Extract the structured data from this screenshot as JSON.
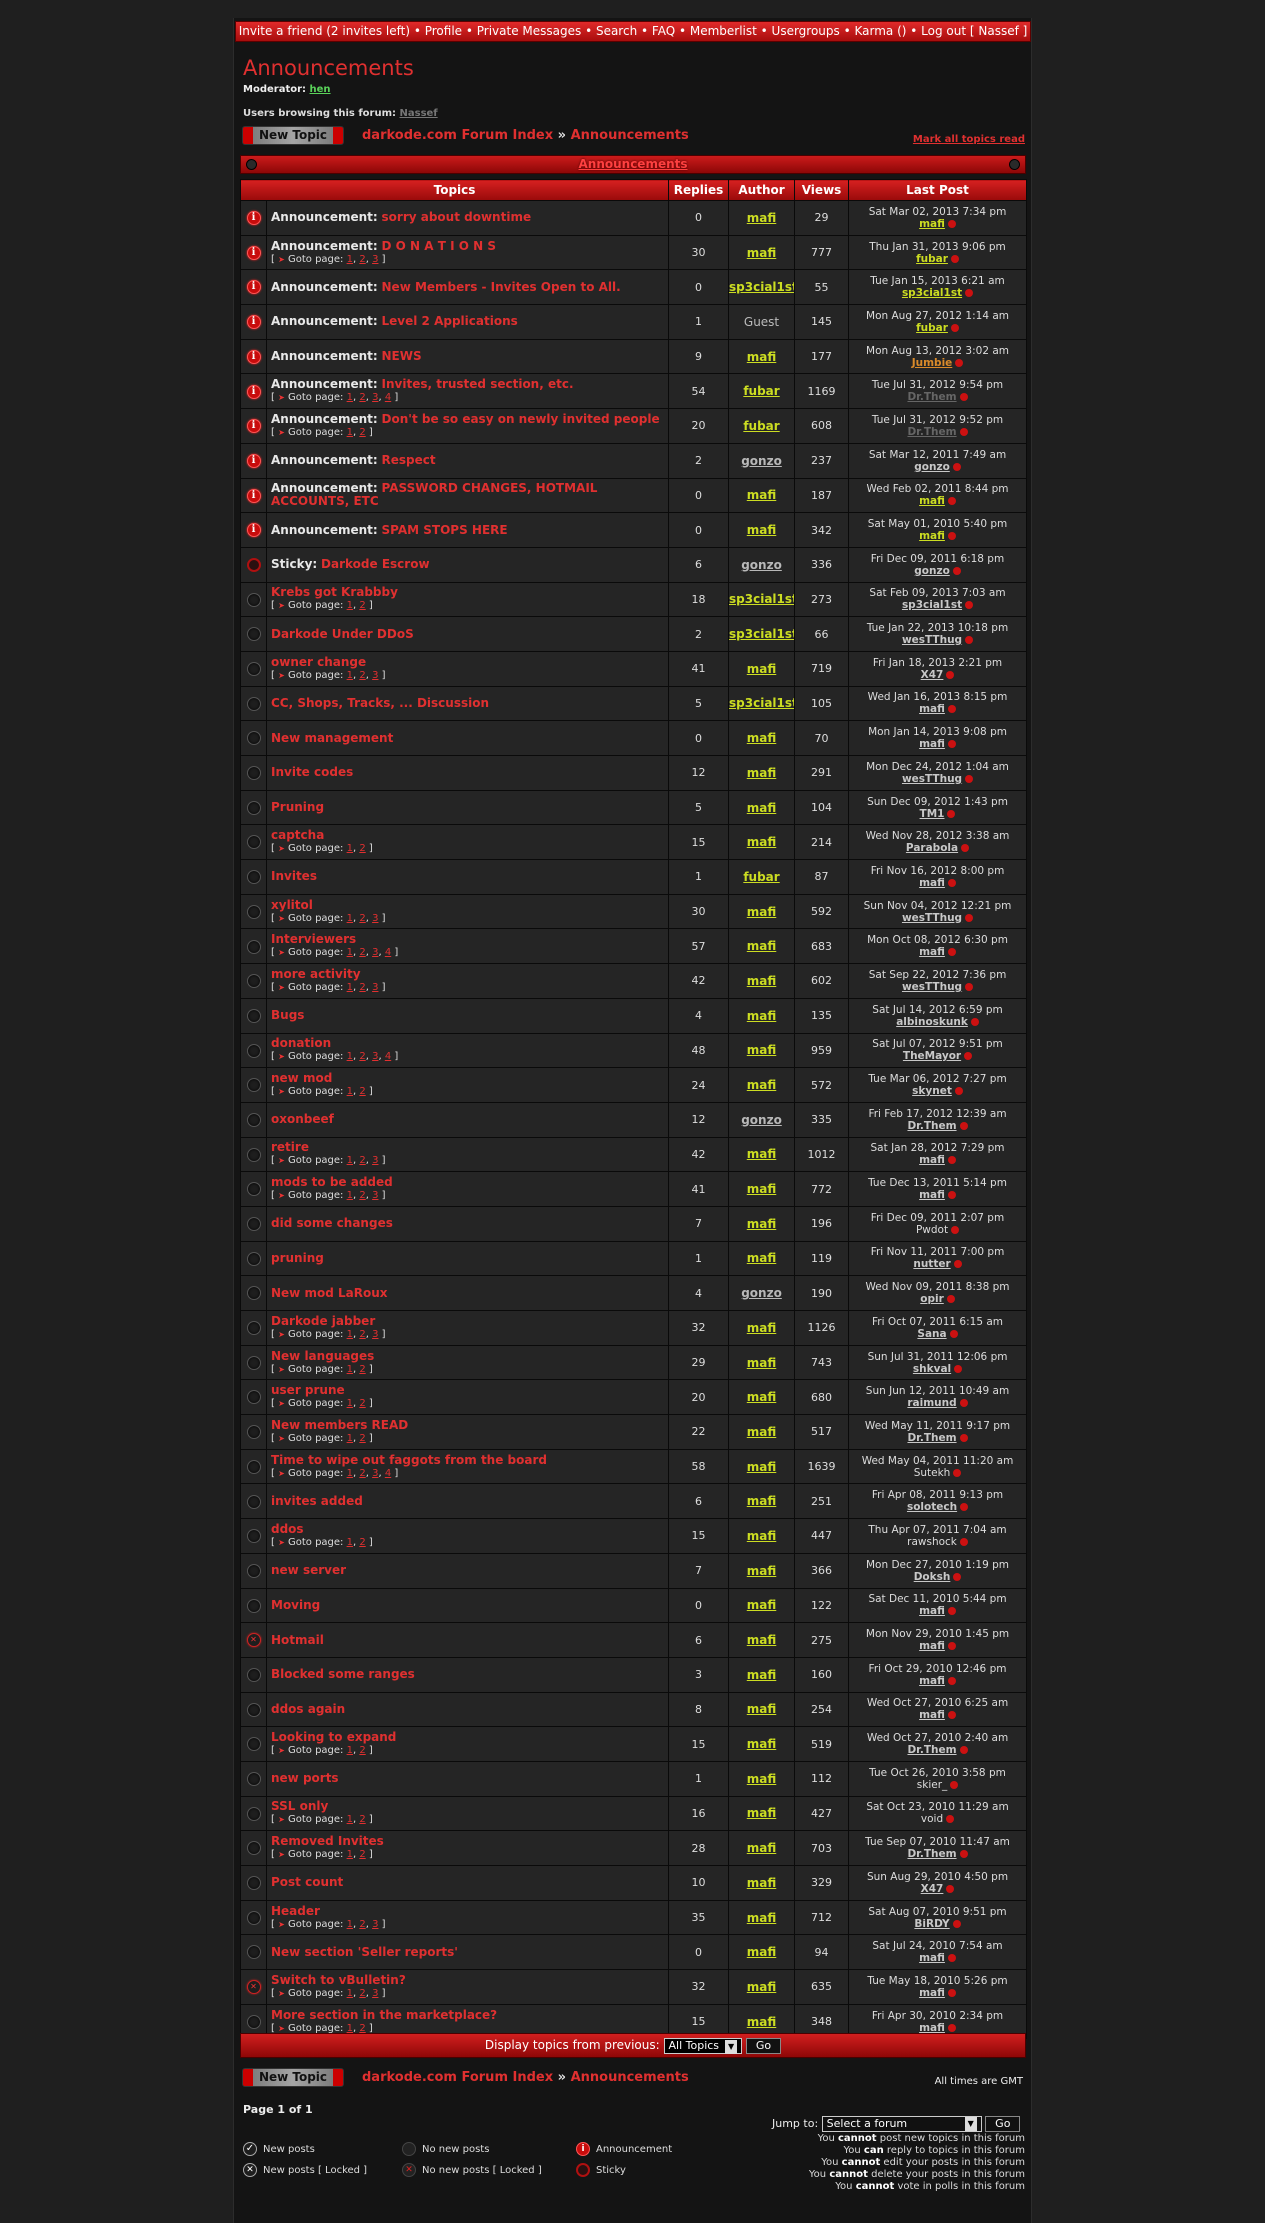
{
  "topnav": "Invite a friend (2 invites left) • Profile • Private Messages • Search • FAQ • Memberlist • Usergroups • Karma () • Log out [ Nassef ]",
  "forum": {
    "title": "Announcements",
    "moderator_label": "Moderator:",
    "moderator": "hen",
    "browsing_label": "Users browsing this forum:",
    "browsing_user": "Nassef"
  },
  "actions": {
    "new_topic": "New Topic",
    "mark_read": "Mark all topics read"
  },
  "breadcrumb": {
    "index": "darkode.com Forum Index",
    "sep": "»",
    "current": "Announcements"
  },
  "table": {
    "caption": "Announcements",
    "headers": {
      "topics": "Topics",
      "replies": "Replies",
      "author": "Author",
      "views": "Views",
      "last_post": "Last Post"
    },
    "goto_label": "Goto page:",
    "rows": [
      {
        "icon": "announcement",
        "prefix": "Announcement:",
        "title": "sorry about downtime",
        "pages": [],
        "replies": "0",
        "author": "mafi",
        "ac": "yellow",
        "views": "29",
        "date": "Sat Mar 02, 2013 7:34 pm",
        "user": "mafi",
        "uc": "yellow"
      },
      {
        "icon": "announcement",
        "prefix": "Announcement:",
        "title": "D O N A T I O N S",
        "pages": [
          "1",
          "2",
          "3"
        ],
        "replies": "30",
        "author": "mafi",
        "ac": "yellow",
        "views": "777",
        "date": "Thu Jan 31, 2013 9:06 pm",
        "user": "fubar",
        "uc": "yellow"
      },
      {
        "icon": "announcement",
        "prefix": "Announcement:",
        "title": "New Members - Invites Open to All.",
        "pages": [],
        "replies": "0",
        "author": "sp3cial1st",
        "ac": "yellow",
        "views": "55",
        "date": "Tue Jan 15, 2013 6:21 am",
        "user": "sp3cial1st",
        "uc": "yellow"
      },
      {
        "icon": "announcement",
        "prefix": "Announcement:",
        "title": "Level 2 Applications",
        "pages": [],
        "replies": "1",
        "author": "Guest",
        "ac": "plain",
        "views": "145",
        "date": "Mon Aug 27, 2012 1:14 am",
        "user": "fubar",
        "uc": "yellow"
      },
      {
        "icon": "announcement",
        "prefix": "Announcement:",
        "title": "NEWS",
        "pages": [],
        "replies": "9",
        "author": "mafi",
        "ac": "yellow",
        "views": "177",
        "date": "Mon Aug 13, 2012 3:02 am",
        "user": "Jumbie",
        "uc": "orange"
      },
      {
        "icon": "announcement",
        "prefix": "Announcement:",
        "title": "Invites, trusted section, etc.",
        "pages": [
          "1",
          "2",
          "3",
          "4"
        ],
        "replies": "54",
        "author": "fubar",
        "ac": "yellow",
        "views": "1169",
        "date": "Tue Jul 31, 2012 9:54 pm",
        "user": "Dr.Them",
        "uc": "dim"
      },
      {
        "icon": "announcement",
        "prefix": "Announcement:",
        "title": "Don't be so easy on newly invited people",
        "pages": [
          "1",
          "2"
        ],
        "replies": "20",
        "author": "fubar",
        "ac": "yellow",
        "views": "608",
        "date": "Tue Jul 31, 2012 9:52 pm",
        "user": "Dr.Them",
        "uc": "dim"
      },
      {
        "icon": "announcement",
        "prefix": "Announcement:",
        "title": "Respect",
        "pages": [],
        "replies": "2",
        "author": "gonzo",
        "ac": "gray",
        "views": "237",
        "date": "Sat Mar 12, 2011 7:49 am",
        "user": "gonzo",
        "uc": "gray"
      },
      {
        "icon": "announcement",
        "prefix": "Announcement:",
        "title": "PASSWORD CHANGES, HOTMAIL ACCOUNTS, ETC",
        "pages": [],
        "replies": "0",
        "author": "mafi",
        "ac": "yellow",
        "views": "187",
        "date": "Wed Feb 02, 2011 8:44 pm",
        "user": "mafi",
        "uc": "yellow"
      },
      {
        "icon": "announcement",
        "prefix": "Announcement:",
        "title": "SPAM STOPS HERE",
        "pages": [],
        "replies": "0",
        "author": "mafi",
        "ac": "yellow",
        "views": "342",
        "date": "Sat May 01, 2010 5:40 pm",
        "user": "mafi",
        "uc": "yellow"
      },
      {
        "icon": "sticky",
        "prefix": "Sticky:",
        "title": "Darkode Escrow",
        "pages": [],
        "replies": "6",
        "author": "gonzo",
        "ac": "gray",
        "views": "336",
        "date": "Fri Dec 09, 2011 6:18 pm",
        "user": "gonzo",
        "uc": "gray"
      },
      {
        "icon": "normal",
        "prefix": "",
        "title": "Krebs got Krabbby",
        "pages": [
          "1",
          "2"
        ],
        "replies": "18",
        "author": "sp3cial1st",
        "ac": "yellow",
        "views": "273",
        "date": "Sat Feb 09, 2013 7:03 am",
        "user": "sp3cial1st",
        "uc": "gray"
      },
      {
        "icon": "normal",
        "prefix": "",
        "title": "Darkode Under DDoS",
        "pages": [],
        "replies": "2",
        "author": "sp3cial1st",
        "ac": "yellow",
        "views": "66",
        "date": "Tue Jan 22, 2013 10:18 pm",
        "user": "wesTThug",
        "uc": "gray"
      },
      {
        "icon": "normal",
        "prefix": "",
        "title": "owner change",
        "pages": [
          "1",
          "2",
          "3"
        ],
        "replies": "41",
        "author": "mafi",
        "ac": "yellow",
        "views": "719",
        "date": "Fri Jan 18, 2013 2:21 pm",
        "user": "X47",
        "uc": "gray"
      },
      {
        "icon": "normal",
        "prefix": "",
        "title": "CC, Shops, Tracks, ... Discussion",
        "pages": [],
        "replies": "5",
        "author": "sp3cial1st",
        "ac": "yellow",
        "views": "105",
        "date": "Wed Jan 16, 2013 8:15 pm",
        "user": "mafi",
        "uc": "gray"
      },
      {
        "icon": "normal",
        "prefix": "",
        "title": "New management",
        "pages": [],
        "replies": "0",
        "author": "mafi",
        "ac": "yellow",
        "views": "70",
        "date": "Mon Jan 14, 2013 9:08 pm",
        "user": "mafi",
        "uc": "gray"
      },
      {
        "icon": "normal",
        "prefix": "",
        "title": "Invite codes",
        "pages": [],
        "replies": "12",
        "author": "mafi",
        "ac": "yellow",
        "views": "291",
        "date": "Mon Dec 24, 2012 1:04 am",
        "user": "wesTThug",
        "uc": "gray"
      },
      {
        "icon": "normal",
        "prefix": "",
        "title": "Pruning",
        "pages": [],
        "replies": "5",
        "author": "mafi",
        "ac": "yellow",
        "views": "104",
        "date": "Sun Dec 09, 2012 1:43 pm",
        "user": "TM1",
        "uc": "gray"
      },
      {
        "icon": "normal",
        "prefix": "",
        "title": "captcha",
        "pages": [
          "1",
          "2"
        ],
        "replies": "15",
        "author": "mafi",
        "ac": "yellow",
        "views": "214",
        "date": "Wed Nov 28, 2012 3:38 am",
        "user": "Parabola",
        "uc": "gray"
      },
      {
        "icon": "normal",
        "prefix": "",
        "title": "Invites",
        "pages": [],
        "replies": "1",
        "author": "fubar",
        "ac": "yellow",
        "views": "87",
        "date": "Fri Nov 16, 2012 8:00 pm",
        "user": "mafi",
        "uc": "gray"
      },
      {
        "icon": "normal",
        "prefix": "",
        "title": "xylitol",
        "pages": [
          "1",
          "2",
          "3"
        ],
        "replies": "30",
        "author": "mafi",
        "ac": "yellow",
        "views": "592",
        "date": "Sun Nov 04, 2012 12:21 pm",
        "user": "wesTThug",
        "uc": "gray"
      },
      {
        "icon": "normal",
        "prefix": "",
        "title": "Interviewers",
        "pages": [
          "1",
          "2",
          "3",
          "4"
        ],
        "replies": "57",
        "author": "mafi",
        "ac": "yellow",
        "views": "683",
        "date": "Mon Oct 08, 2012 6:30 pm",
        "user": "mafi",
        "uc": "gray"
      },
      {
        "icon": "normal",
        "prefix": "",
        "title": "more activity",
        "pages": [
          "1",
          "2",
          "3"
        ],
        "replies": "42",
        "author": "mafi",
        "ac": "yellow",
        "views": "602",
        "date": "Sat Sep 22, 2012 7:36 pm",
        "user": "wesTThug",
        "uc": "gray"
      },
      {
        "icon": "normal",
        "prefix": "",
        "title": "Bugs",
        "pages": [],
        "replies": "4",
        "author": "mafi",
        "ac": "yellow",
        "views": "135",
        "date": "Sat Jul 14, 2012 6:59 pm",
        "user": "albinoskunk",
        "uc": "gray"
      },
      {
        "icon": "normal",
        "prefix": "",
        "title": "donation",
        "pages": [
          "1",
          "2",
          "3",
          "4"
        ],
        "replies": "48",
        "author": "mafi",
        "ac": "yellow",
        "views": "959",
        "date": "Sat Jul 07, 2012 9:51 pm",
        "user": "TheMayor",
        "uc": "gray"
      },
      {
        "icon": "normal",
        "prefix": "",
        "title": "new mod",
        "pages": [
          "1",
          "2"
        ],
        "replies": "24",
        "author": "mafi",
        "ac": "yellow",
        "views": "572",
        "date": "Tue Mar 06, 2012 7:27 pm",
        "user": "skynet",
        "uc": "gray"
      },
      {
        "icon": "normal",
        "prefix": "",
        "title": "oxonbeef",
        "pages": [],
        "replies": "12",
        "author": "gonzo",
        "ac": "gray",
        "views": "335",
        "date": "Fri Feb 17, 2012 12:39 am",
        "user": "Dr.Them",
        "uc": "gray"
      },
      {
        "icon": "normal",
        "prefix": "",
        "title": "retire",
        "pages": [
          "1",
          "2",
          "3"
        ],
        "replies": "42",
        "author": "mafi",
        "ac": "yellow",
        "views": "1012",
        "date": "Sat Jan 28, 2012 7:29 pm",
        "user": "mafi",
        "uc": "gray"
      },
      {
        "icon": "normal",
        "prefix": "",
        "title": "mods to be added",
        "pages": [
          "1",
          "2",
          "3"
        ],
        "replies": "41",
        "author": "mafi",
        "ac": "yellow",
        "views": "772",
        "date": "Tue Dec 13, 2011 5:14 pm",
        "user": "mafi",
        "uc": "gray"
      },
      {
        "icon": "normal",
        "prefix": "",
        "title": "did some changes",
        "pages": [],
        "replies": "7",
        "author": "mafi",
        "ac": "yellow",
        "views": "196",
        "date": "Fri Dec 09, 2011 2:07 pm",
        "user": "Pwdot",
        "uc": "plain"
      },
      {
        "icon": "normal",
        "prefix": "",
        "title": "pruning",
        "pages": [],
        "replies": "1",
        "author": "mafi",
        "ac": "yellow",
        "views": "119",
        "date": "Fri Nov 11, 2011 7:00 pm",
        "user": "nutter",
        "uc": "gray"
      },
      {
        "icon": "normal",
        "prefix": "",
        "title": "New mod LaRoux",
        "pages": [],
        "replies": "4",
        "author": "gonzo",
        "ac": "gray",
        "views": "190",
        "date": "Wed Nov 09, 2011 8:38 pm",
        "user": "opir",
        "uc": "gray"
      },
      {
        "icon": "normal",
        "prefix": "",
        "title": "Darkode jabber",
        "pages": [
          "1",
          "2",
          "3"
        ],
        "replies": "32",
        "author": "mafi",
        "ac": "yellow",
        "views": "1126",
        "date": "Fri Oct 07, 2011 6:15 am",
        "user": "Sana",
        "uc": "gray"
      },
      {
        "icon": "normal",
        "prefix": "",
        "title": "New languages",
        "pages": [
          "1",
          "2"
        ],
        "replies": "29",
        "author": "mafi",
        "ac": "yellow",
        "views": "743",
        "date": "Sun Jul 31, 2011 12:06 pm",
        "user": "shkval",
        "uc": "gray"
      },
      {
        "icon": "normal",
        "prefix": "",
        "title": "user prune",
        "pages": [
          "1",
          "2"
        ],
        "replies": "20",
        "author": "mafi",
        "ac": "yellow",
        "views": "680",
        "date": "Sun Jun 12, 2011 10:49 am",
        "user": "raimund",
        "uc": "gray"
      },
      {
        "icon": "normal",
        "prefix": "",
        "title": "New members READ",
        "pages": [
          "1",
          "2"
        ],
        "replies": "22",
        "author": "mafi",
        "ac": "yellow",
        "views": "517",
        "date": "Wed May 11, 2011 9:17 pm",
        "user": "Dr.Them",
        "uc": "gray"
      },
      {
        "icon": "normal",
        "prefix": "",
        "title": "Time to wipe out faggots from the board",
        "pages": [
          "1",
          "2",
          "3",
          "4"
        ],
        "replies": "58",
        "author": "mafi",
        "ac": "yellow",
        "views": "1639",
        "date": "Wed May 04, 2011 11:20 am",
        "user": "Sutekh",
        "uc": "plain"
      },
      {
        "icon": "normal",
        "prefix": "",
        "title": "invites added",
        "pages": [],
        "replies": "6",
        "author": "mafi",
        "ac": "yellow",
        "views": "251",
        "date": "Fri Apr 08, 2011 9:13 pm",
        "user": "solotech",
        "uc": "gray"
      },
      {
        "icon": "normal",
        "prefix": "",
        "title": "ddos",
        "pages": [
          "1",
          "2"
        ],
        "replies": "15",
        "author": "mafi",
        "ac": "yellow",
        "views": "447",
        "date": "Thu Apr 07, 2011 7:04 am",
        "user": "rawshock",
        "uc": "plain"
      },
      {
        "icon": "normal",
        "prefix": "",
        "title": "new server",
        "pages": [],
        "replies": "7",
        "author": "mafi",
        "ac": "yellow",
        "views": "366",
        "date": "Mon Dec 27, 2010 1:19 pm",
        "user": "Doksh",
        "uc": "gray"
      },
      {
        "icon": "normal",
        "prefix": "",
        "title": "Moving",
        "pages": [],
        "replies": "0",
        "author": "mafi",
        "ac": "yellow",
        "views": "122",
        "date": "Sat Dec 11, 2010 5:44 pm",
        "user": "mafi",
        "uc": "gray"
      },
      {
        "icon": "new-locked",
        "prefix": "",
        "title": "Hotmail",
        "pages": [],
        "replies": "6",
        "author": "mafi",
        "ac": "yellow",
        "views": "275",
        "date": "Mon Nov 29, 2010 1:45 pm",
        "user": "mafi",
        "uc": "gray"
      },
      {
        "icon": "normal",
        "prefix": "",
        "title": "Blocked some ranges",
        "pages": [],
        "replies": "3",
        "author": "mafi",
        "ac": "yellow",
        "views": "160",
        "date": "Fri Oct 29, 2010 12:46 pm",
        "user": "mafi",
        "uc": "gray"
      },
      {
        "icon": "normal",
        "prefix": "",
        "title": "ddos again",
        "pages": [],
        "replies": "8",
        "author": "mafi",
        "ac": "yellow",
        "views": "254",
        "date": "Wed Oct 27, 2010 6:25 am",
        "user": "mafi",
        "uc": "gray"
      },
      {
        "icon": "normal",
        "prefix": "",
        "title": "Looking to expand",
        "pages": [
          "1",
          "2"
        ],
        "replies": "15",
        "author": "mafi",
        "ac": "yellow",
        "views": "519",
        "date": "Wed Oct 27, 2010 2:40 am",
        "user": "Dr.Them",
        "uc": "gray"
      },
      {
        "icon": "normal",
        "prefix": "",
        "title": "new ports",
        "pages": [],
        "replies": "1",
        "author": "mafi",
        "ac": "yellow",
        "views": "112",
        "date": "Tue Oct 26, 2010 3:58 pm",
        "user": "skier_",
        "uc": "plain"
      },
      {
        "icon": "normal",
        "prefix": "",
        "title": "SSL only",
        "pages": [
          "1",
          "2"
        ],
        "replies": "16",
        "author": "mafi",
        "ac": "yellow",
        "views": "427",
        "date": "Sat Oct 23, 2010 11:29 am",
        "user": "void",
        "uc": "plain"
      },
      {
        "icon": "normal",
        "prefix": "",
        "title": "Removed Invites",
        "pages": [
          "1",
          "2"
        ],
        "replies": "28",
        "author": "mafi",
        "ac": "yellow",
        "views": "703",
        "date": "Tue Sep 07, 2010 11:47 am",
        "user": "Dr.Them",
        "uc": "gray"
      },
      {
        "icon": "normal",
        "prefix": "",
        "title": "Post count",
        "pages": [],
        "replies": "10",
        "author": "mafi",
        "ac": "yellow",
        "views": "329",
        "date": "Sun Aug 29, 2010 4:50 pm",
        "user": "X47",
        "uc": "gray"
      },
      {
        "icon": "normal",
        "prefix": "",
        "title": "Header",
        "pages": [
          "1",
          "2",
          "3"
        ],
        "replies": "35",
        "author": "mafi",
        "ac": "yellow",
        "views": "712",
        "date": "Sat Aug 07, 2010 9:51 pm",
        "user": "BiRDY",
        "uc": "gray"
      },
      {
        "icon": "normal",
        "prefix": "",
        "title": "New section 'Seller reports'",
        "pages": [],
        "replies": "0",
        "author": "mafi",
        "ac": "yellow",
        "views": "94",
        "date": "Sat Jul 24, 2010 7:54 am",
        "user": "mafi",
        "uc": "gray"
      },
      {
        "icon": "new-locked",
        "prefix": "",
        "title": "Switch to vBulletin?",
        "pages": [
          "1",
          "2",
          "3"
        ],
        "replies": "32",
        "author": "mafi",
        "ac": "yellow",
        "views": "635",
        "date": "Tue May 18, 2010 5:26 pm",
        "user": "mafi",
        "uc": "gray"
      },
      {
        "icon": "normal",
        "prefix": "",
        "title": "More section in the marketplace?",
        "pages": [
          "1",
          "2"
        ],
        "replies": "15",
        "author": "mafi",
        "ac": "yellow",
        "views": "348",
        "date": "Fri Apr 30, 2010 2:34 pm",
        "user": "mafi",
        "uc": "gray"
      }
    ]
  },
  "footer_bar": {
    "label": "Display topics from previous:",
    "select": "All Topics",
    "go": "Go"
  },
  "timezone": "All times are GMT",
  "pagination": "Page 1 of 1",
  "jump": {
    "label": "Jump to:",
    "select": "Select a forum",
    "go": "Go"
  },
  "legend": {
    "new_posts": "New posts",
    "no_new_posts": "No new posts",
    "announcement": "Announcement",
    "new_posts_locked": "New posts [ Locked ]",
    "no_new_posts_locked": "No new posts [ Locked ]",
    "sticky": "Sticky"
  },
  "permissions": [
    [
      "You",
      "cannot",
      "post new topics in this forum"
    ],
    [
      "You",
      "can",
      "reply to topics in this forum"
    ],
    [
      "You",
      "cannot",
      "edit your posts in this forum"
    ],
    [
      "You",
      "cannot",
      "delete your posts in this forum"
    ],
    [
      "You",
      "cannot",
      "vote in polls in this forum"
    ]
  ],
  "colors": {
    "accent_red": "#e03030",
    "author_yellow": "#ccdd22",
    "moderator_green": "#5ad35a",
    "header_red": "#b01010"
  }
}
